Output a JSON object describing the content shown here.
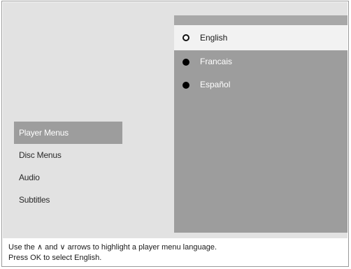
{
  "left_menu": {
    "items": [
      {
        "label": "Player Menus"
      },
      {
        "label": "Disc Menus"
      },
      {
        "label": "Audio"
      },
      {
        "label": "Subtitles"
      }
    ],
    "selected": "Player Menus"
  },
  "language_panel": {
    "options": [
      {
        "label": "English",
        "radio_icon": "radio-open-icon"
      },
      {
        "label": "Francais",
        "radio_icon": "radio-filled-icon"
      },
      {
        "label": "Español",
        "radio_icon": "radio-filled-icon"
      }
    ],
    "highlighted": "English"
  },
  "help": {
    "line1": "Use the ∧ and ∨ arrows to highlight a player menu language.",
    "line2": "Press OK to select English."
  },
  "colors": {
    "screen_bg": "#e2e2e2",
    "panel_bg": "#9d9d9d",
    "highlight_bg": "#f2f2f2",
    "selected_menu_bg": "#9d9d9d"
  }
}
